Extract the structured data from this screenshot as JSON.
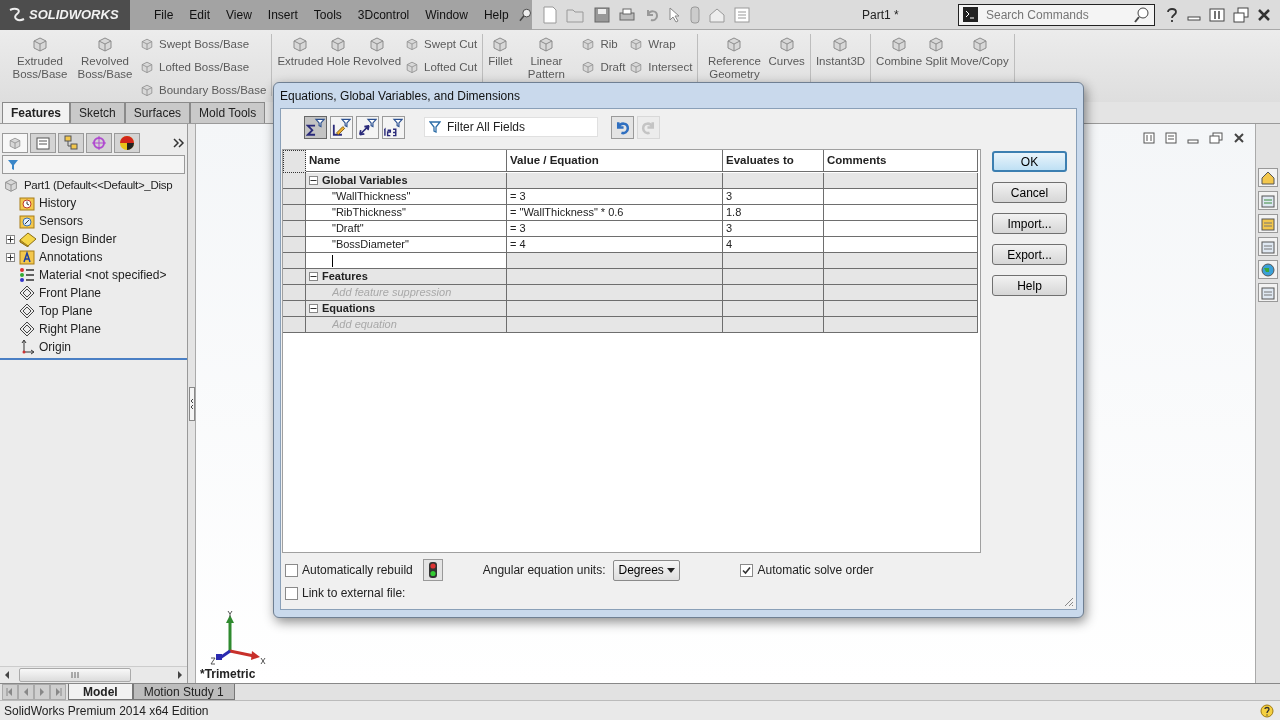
{
  "app_bar": {
    "logo": "SOLIDWORKS",
    "menu": [
      "File",
      "Edit",
      "View",
      "Insert",
      "Tools",
      "3Dcontrol",
      "Window",
      "Help"
    ],
    "document_title": "Part1 *",
    "search": {
      "placeholder": "Search Commands"
    }
  },
  "ribbon": {
    "groups": [
      {
        "items": [
          {
            "kind": "large",
            "label": "Extruded Boss/Base"
          },
          {
            "kind": "large",
            "label": "Revolved Boss/Base"
          },
          {
            "kind": "stack",
            "labels": [
              "Swept Boss/Base",
              "Lofted Boss/Base",
              "Boundary Boss/Base"
            ]
          }
        ]
      },
      {
        "items": [
          {
            "kind": "large",
            "label": "Extruded"
          },
          {
            "kind": "large",
            "label": "Hole"
          },
          {
            "kind": "large",
            "label": "Revolved"
          },
          {
            "kind": "stack",
            "labels": [
              "Swept Cut",
              "Lofted Cut"
            ]
          }
        ]
      },
      {
        "items": [
          {
            "kind": "large",
            "label": "Fillet"
          },
          {
            "kind": "large",
            "label": "Linear Pattern"
          },
          {
            "kind": "stack",
            "labels": [
              "Rib",
              "Draft"
            ]
          },
          {
            "kind": "stack",
            "labels": [
              "Wrap",
              "Intersect"
            ]
          }
        ]
      },
      {
        "items": [
          {
            "kind": "large",
            "label": "Reference Geometry"
          },
          {
            "kind": "large",
            "label": "Curves"
          }
        ]
      },
      {
        "items": [
          {
            "kind": "large",
            "label": "Instant3D"
          }
        ]
      },
      {
        "items": [
          {
            "kind": "large",
            "label": "Combine"
          },
          {
            "kind": "large",
            "label": "Split"
          },
          {
            "kind": "large",
            "label": "Move/Copy"
          }
        ]
      }
    ]
  },
  "command_tabs": [
    {
      "label": "Features",
      "selected": true
    },
    {
      "label": "Sketch",
      "selected": false
    },
    {
      "label": "Surfaces",
      "selected": false
    },
    {
      "label": "Mold Tools",
      "selected": false
    }
  ],
  "feature_tree": {
    "label": "Part1  (Default<<Default>_Disp",
    "children": [
      {
        "label": "History",
        "kind": "history",
        "expandable": false
      },
      {
        "label": "Sensors",
        "kind": "sensors",
        "expandable": false
      },
      {
        "label": "Design Binder",
        "kind": "binder",
        "expandable": true
      },
      {
        "label": "Annotations",
        "kind": "annotations",
        "expandable": true
      },
      {
        "label": "Material <not specified>",
        "kind": "material",
        "expandable": false
      },
      {
        "label": "Front Plane",
        "kind": "plane",
        "expandable": false
      },
      {
        "label": "Top Plane",
        "kind": "plane",
        "expandable": false
      },
      {
        "label": "Right Plane",
        "kind": "plane",
        "expandable": false
      },
      {
        "label": "Origin",
        "kind": "origin",
        "expandable": false
      }
    ]
  },
  "graphics": {
    "view_name": "*Trimetric"
  },
  "bottom_tabs": [
    {
      "label": "Model",
      "selected": true
    },
    {
      "label": "Motion Study 1",
      "selected": false
    }
  ],
  "status_bar": {
    "text": "SolidWorks Premium 2014 x64 Edition"
  },
  "dialog": {
    "title": "Equations, Global Variables, and Dimensions",
    "view_buttons": [
      {
        "selected": true
      },
      {
        "selected": false
      },
      {
        "selected": false
      },
      {
        "selected": false
      }
    ],
    "filter": {
      "placeholder": "Filter All Fields"
    },
    "history_buttons": [
      {
        "kind": "undo",
        "disabled": false
      },
      {
        "kind": "redo",
        "disabled": true
      }
    ],
    "table": {
      "columns": [
        "Name",
        "Value / Equation",
        "Evaluates to",
        "Comments"
      ],
      "sections": [
        {
          "title": "Global Variables",
          "expanded": true,
          "rows": [
            {
              "kind": "entry",
              "name": "\"WallThickness\"",
              "value": "= 3",
              "result": "3"
            },
            {
              "kind": "entry",
              "name": "\"RibThickness\"",
              "value": "= \"WallThickness\" * 0.6",
              "result": "1.8"
            },
            {
              "kind": "entry",
              "name": "\"Draft\"",
              "value": "= 3",
              "result": "3"
            },
            {
              "kind": "entry",
              "name": "\"BossDiameter\"",
              "value": "= 4",
              "result": "4"
            },
            {
              "kind": "editing"
            }
          ]
        },
        {
          "title": "Features",
          "expanded": true,
          "rows": [
            {
              "kind": "new",
              "placeholder": "Add feature suppression"
            }
          ]
        },
        {
          "title": "Equations",
          "expanded": true,
          "rows": [
            {
              "kind": "new",
              "placeholder": "Add equation"
            }
          ]
        }
      ]
    },
    "buttons": [
      {
        "label": "OK",
        "default": true
      },
      {
        "label": "Cancel",
        "default": false
      },
      {
        "label": "Import...",
        "default": false
      },
      {
        "label": "Export...",
        "default": false
      },
      {
        "label": "Help",
        "default": false
      }
    ],
    "auto_rebuild": {
      "label": "Automatically rebuild",
      "checked": false
    },
    "angular_units": {
      "label": "Angular equation units:",
      "value": "Degrees"
    },
    "solve_order": {
      "label": "Automatic solve order",
      "checked": true
    },
    "external_file": {
      "label": "Link to external file:",
      "checked": false
    }
  }
}
